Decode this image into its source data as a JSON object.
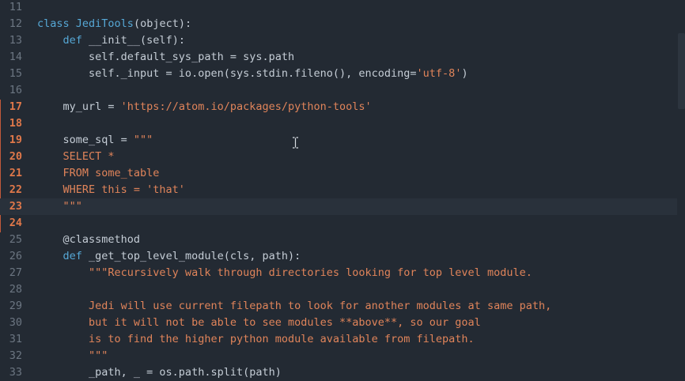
{
  "editor": {
    "lines": [
      {
        "n": "11",
        "mod": false,
        "tokens": []
      },
      {
        "n": "12",
        "mod": false,
        "tokens": [
          {
            "t": "class ",
            "c": "kw"
          },
          {
            "t": "JediTools",
            "c": "cls"
          },
          {
            "t": "(object):",
            "c": "plain"
          }
        ]
      },
      {
        "n": "13",
        "mod": false,
        "tokens": [
          {
            "t": "    def ",
            "c": "kw"
          },
          {
            "t": "__init__(self):",
            "c": "plain"
          }
        ]
      },
      {
        "n": "14",
        "mod": false,
        "tokens": [
          {
            "t": "        self.default_sys_path = sys.path",
            "c": "plain"
          }
        ]
      },
      {
        "n": "15",
        "mod": false,
        "tokens": [
          {
            "t": "        self._input = io.open(sys.stdin.fileno(), encoding=",
            "c": "plain"
          },
          {
            "t": "'utf-8'",
            "c": "str"
          },
          {
            "t": ")",
            "c": "plain"
          }
        ]
      },
      {
        "n": "16",
        "mod": false,
        "tokens": []
      },
      {
        "n": "17",
        "mod": true,
        "tokens": [
          {
            "t": "    my_url = ",
            "c": "plain"
          },
          {
            "t": "'https://atom.io/packages/python-tools'",
            "c": "str"
          }
        ]
      },
      {
        "n": "18",
        "mod": true,
        "tokens": []
      },
      {
        "n": "19",
        "mod": true,
        "tokens": [
          {
            "t": "    some_sql = ",
            "c": "plain"
          },
          {
            "t": "\"\"\"",
            "c": "str"
          }
        ]
      },
      {
        "n": "20",
        "mod": true,
        "tokens": [
          {
            "t": "    SELECT *",
            "c": "str"
          }
        ]
      },
      {
        "n": "21",
        "mod": true,
        "tokens": [
          {
            "t": "    FROM some_table",
            "c": "str"
          }
        ]
      },
      {
        "n": "22",
        "mod": true,
        "tokens": [
          {
            "t": "    WHERE this = 'that'",
            "c": "str"
          }
        ]
      },
      {
        "n": "23",
        "mod": true,
        "cursor": true,
        "tokens": [
          {
            "t": "    \"\"\"",
            "c": "str"
          }
        ]
      },
      {
        "n": "24",
        "mod": true,
        "tokens": []
      },
      {
        "n": "25",
        "mod": false,
        "tokens": [
          {
            "t": "    @classmethod",
            "c": "plain"
          }
        ]
      },
      {
        "n": "26",
        "mod": false,
        "tokens": [
          {
            "t": "    def ",
            "c": "kw"
          },
          {
            "t": "_get_top_level_module(cls, path):",
            "c": "plain"
          }
        ]
      },
      {
        "n": "27",
        "mod": false,
        "tokens": [
          {
            "t": "        \"\"\"Recursively walk through directories looking for top level module.",
            "c": "str"
          }
        ]
      },
      {
        "n": "28",
        "mod": false,
        "tokens": []
      },
      {
        "n": "29",
        "mod": false,
        "tokens": [
          {
            "t": "        Jedi will use current filepath to look for another modules at same path,",
            "c": "str"
          }
        ]
      },
      {
        "n": "30",
        "mod": false,
        "tokens": [
          {
            "t": "        but it will not be able to see modules **above**, so our goal",
            "c": "str"
          }
        ]
      },
      {
        "n": "31",
        "mod": false,
        "tokens": [
          {
            "t": "        is to find the higher python module available from filepath.",
            "c": "str"
          }
        ]
      },
      {
        "n": "32",
        "mod": false,
        "tokens": [
          {
            "t": "        \"\"\"",
            "c": "str"
          }
        ]
      },
      {
        "n": "33",
        "mod": false,
        "tokens": [
          {
            "t": "        _path, _ = os.path.split(path)",
            "c": "plain"
          }
        ]
      }
    ]
  },
  "colors": {
    "background": "#232a33",
    "keyword": "#56a8d6",
    "string": "#e0845a",
    "modified_line_number": "#e0784a"
  },
  "icons": {
    "cursor": "i-beam-cursor-icon"
  }
}
